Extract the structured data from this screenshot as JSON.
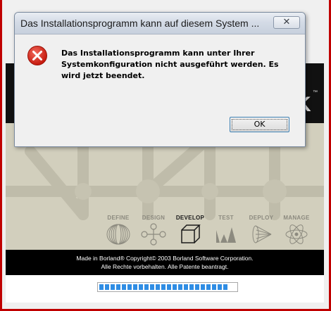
{
  "dialog": {
    "title": "Das Installationsprogramm kann auf diesem System ...",
    "close_glyph": "✕",
    "icon": "error-icon",
    "message": "Das Installationsprogramm kann unter Ihrer Systemkonfiguration nicht ausgeführt werden. Es wird jetzt beendet.",
    "ok_label": "OK"
  },
  "installer": {
    "header_logo_fragment": "K",
    "header_trademark": "™",
    "stages": [
      {
        "label": "DEFINE",
        "icon": "define-rings-icon"
      },
      {
        "label": "DESIGN",
        "icon": "design-nodes-icon"
      },
      {
        "label": "DEVELOP",
        "icon": "develop-cube-icon"
      },
      {
        "label": "TEST",
        "icon": "test-wave-icon"
      },
      {
        "label": "DEPLOY",
        "icon": "deploy-cone-icon"
      },
      {
        "label": "MANAGE",
        "icon": "manage-atom-icon"
      }
    ],
    "active_stage": "DEVELOP",
    "footer_line1": "Made in Borland® Copyright© 2003 Borland Software Corporation.",
    "footer_line2": "Alle Rechte vorbehalten. Alle Patente beantragt.",
    "progress_fraction": 0.95
  },
  "colors": {
    "error_red": "#d92a1c",
    "frame_red": "#c00000",
    "progress_blue": "#2f8de4"
  }
}
